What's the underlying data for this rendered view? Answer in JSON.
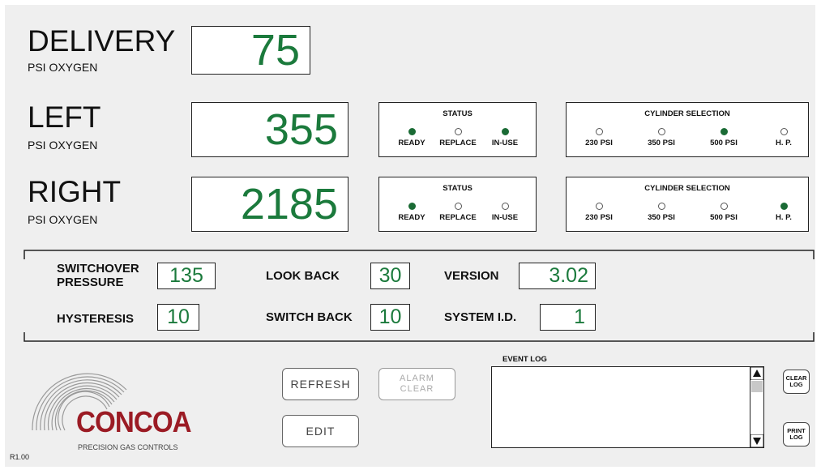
{
  "delivery": {
    "title": "DELIVERY",
    "subtitle": "PSI OXYGEN",
    "value": "75"
  },
  "left": {
    "title": "LEFT",
    "subtitle": "PSI OXYGEN",
    "value": "355",
    "status": {
      "title": "STATUS",
      "ready": "READY",
      "replace": "REPLACE",
      "in_use": "IN-USE",
      "ready_on": true,
      "replace_on": false,
      "in_use_on": true
    },
    "cylinder": {
      "title": "CYLINDER SELECTION",
      "opt1": "230 PSI",
      "opt2": "350 PSI",
      "opt3": "500 PSI",
      "opt4": "H. P.",
      "selected": 3
    }
  },
  "right": {
    "title": "RIGHT",
    "subtitle": "PSI OXYGEN",
    "value": "2185",
    "status": {
      "title": "STATUS",
      "ready": "READY",
      "replace": "REPLACE",
      "in_use": "IN-USE",
      "ready_on": true,
      "replace_on": false,
      "in_use_on": false
    },
    "cylinder": {
      "title": "CYLINDER SELECTION",
      "opt1": "230 PSI",
      "opt2": "350 PSI",
      "opt3": "500 PSI",
      "opt4": "H. P.",
      "selected": 4
    }
  },
  "settings": {
    "switchover_label_1": "SWITCHOVER",
    "switchover_label_2": "PRESSURE",
    "switchover_value": "135",
    "hysteresis_label": "HYSTERESIS",
    "hysteresis_value": "10",
    "lookback_label": "LOOK BACK",
    "lookback_value": "30",
    "switchback_label": "SWITCH BACK",
    "switchback_value": "10",
    "version_label": "VERSION",
    "version_value": "3.02",
    "system_id_label": "SYSTEM I.D.",
    "system_id_value": "1"
  },
  "buttons": {
    "refresh": "REFRESH",
    "alarm_clear_1": "ALARM",
    "alarm_clear_2": "CLEAR",
    "edit": "EDIT",
    "clear_log_1": "CLEAR",
    "clear_log_2": "LOG",
    "print_log_1": "PRINT",
    "print_log_2": "LOG"
  },
  "event_log": {
    "title": "EVENT LOG",
    "entries": []
  },
  "brand": {
    "name": "CONCOA",
    "tagline": "PRECISION GAS CONTROLS",
    "brand_color": "#9b1b24"
  },
  "revision": "R1.00",
  "colors": {
    "readout_green": "#1b7a3c",
    "indicator_on": "#1a6b35",
    "panel_bg": "#efefef"
  }
}
